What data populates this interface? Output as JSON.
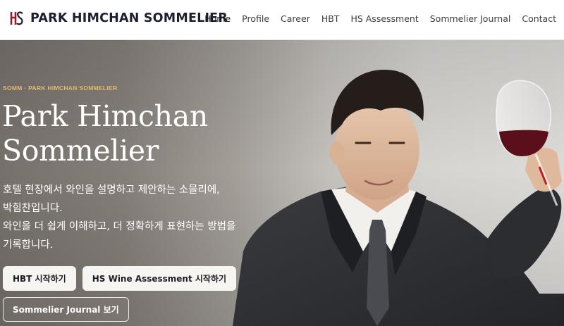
{
  "header": {
    "brand": "PARK HIMCHAN SOMMELIER",
    "logo_icon": "hs-monogram-logo",
    "nav": [
      {
        "label": "Home",
        "active": true
      },
      {
        "label": "Profile"
      },
      {
        "label": "Career"
      },
      {
        "label": "HBT"
      },
      {
        "label": "HS Assessment"
      },
      {
        "label": "Sommelier Journal"
      },
      {
        "label": "Contact"
      }
    ]
  },
  "hero": {
    "eyebrow": "SOMM · PARK HIMCHAN SOMMELIER",
    "title_line1": "Park Himchan",
    "title_line2": "Sommelier",
    "description": [
      "호텔 현장에서 와인을 설명하고 제안하는 소믈리에,",
      "박힘찬입니다.",
      "와인을 더 쉽게 이해하고, 더 정확하게 표현하는 방법을",
      "기록합니다."
    ],
    "buttons": {
      "hbt": "HBT 시작하기",
      "assessment": "HS Wine Assessment 시작하기",
      "journal": "Sommelier Journal 보기"
    }
  },
  "colors": {
    "brand_dark": "#1b1f2e",
    "logo_red": "#8c1d2b",
    "eyebrow_gold": "#e3b873",
    "button_bg": "#f7f5f2"
  }
}
